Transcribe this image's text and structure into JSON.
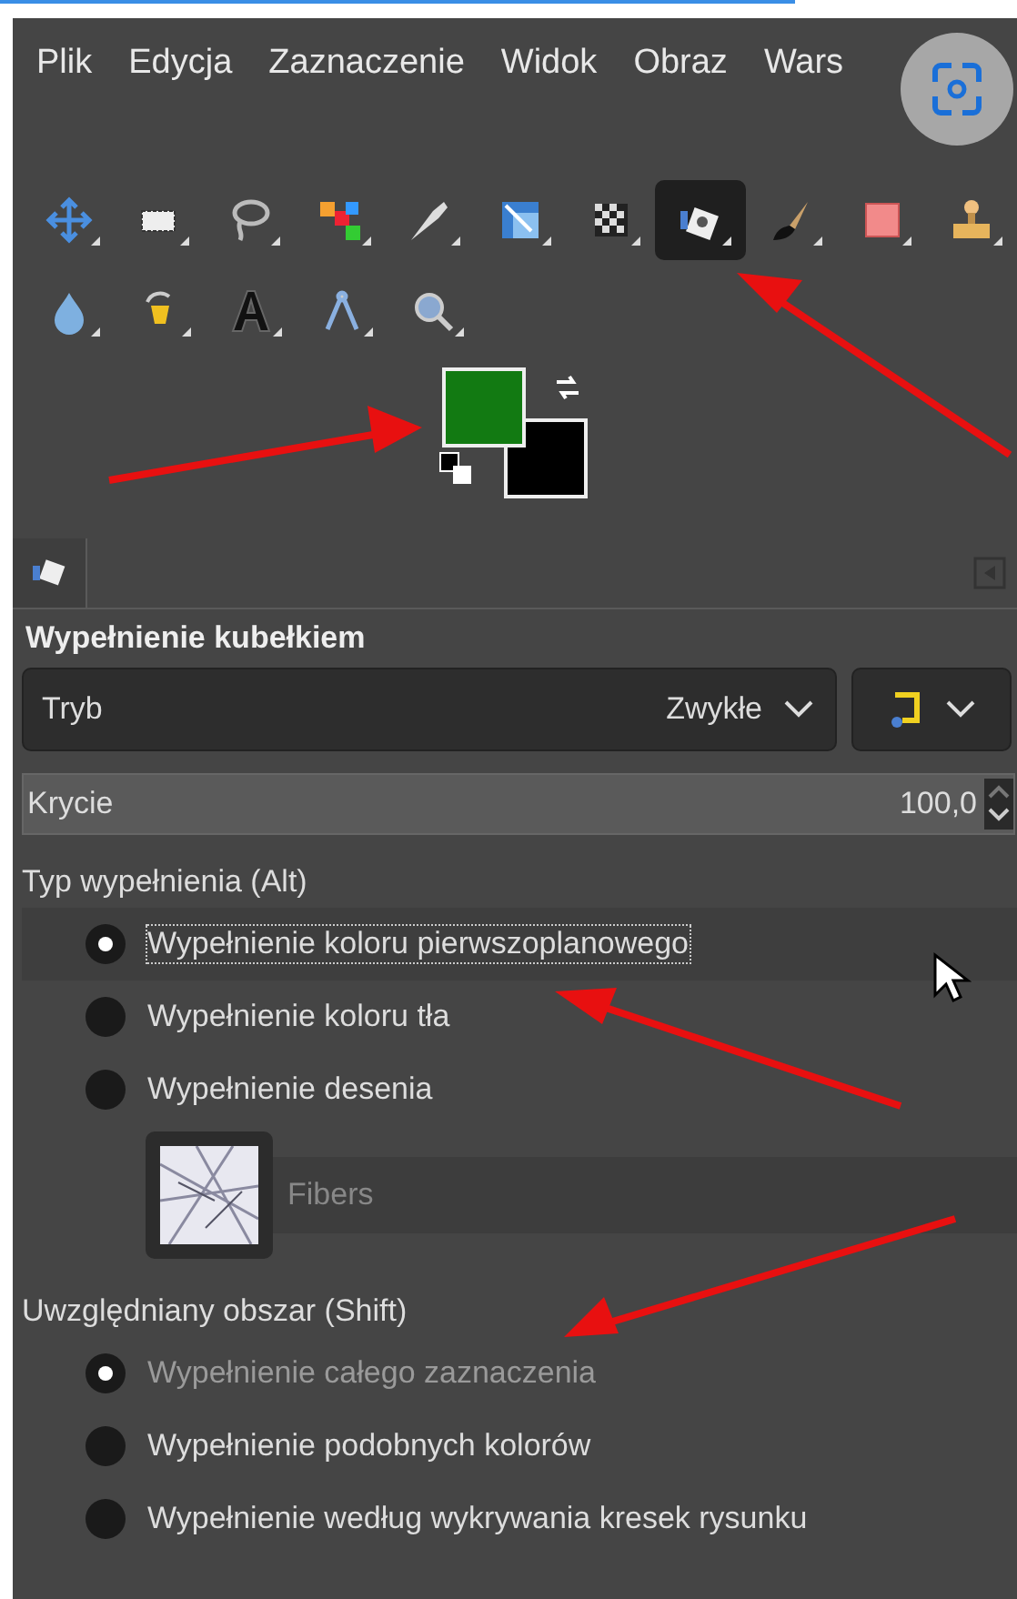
{
  "menu": [
    "Plik",
    "Edycja",
    "Zaznaczenie",
    "Widok",
    "Obraz",
    "Wars"
  ],
  "toolbox": {
    "rows": [
      [
        {
          "kind": "move",
          "selected": false
        },
        {
          "kind": "rectselect",
          "selected": false
        },
        {
          "kind": "lasso",
          "selected": false
        },
        {
          "kind": "colorselect",
          "selected": false
        },
        {
          "kind": "knife",
          "selected": false
        },
        {
          "kind": "transform",
          "selected": false
        },
        {
          "kind": "checker",
          "selected": false
        },
        {
          "kind": "bucket",
          "selected": true
        },
        {
          "kind": "brush",
          "selected": false
        },
        {
          "kind": "eraser",
          "selected": false
        },
        {
          "kind": "stamp",
          "selected": false
        }
      ],
      [
        {
          "kind": "drop",
          "selected": false
        },
        {
          "kind": "pen",
          "selected": false
        },
        {
          "kind": "text",
          "selected": false
        },
        {
          "kind": "measure",
          "selected": false
        },
        {
          "kind": "zoom",
          "selected": false
        }
      ]
    ]
  },
  "tool_options": {
    "title": "Wypełnienie kubełkiem",
    "mode": {
      "label": "Tryb",
      "value": "Zwykłe"
    },
    "opacity": {
      "label": "Krycie",
      "value": "100,0",
      "level": 1.0
    },
    "fill_type": {
      "label": "Typ wypełnienia  (Alt)",
      "options": [
        {
          "label": "Wypełnienie koloru pierwszoplanowego",
          "selected": true,
          "disabled": false
        },
        {
          "label": "Wypełnienie koloru tła",
          "selected": false,
          "disabled": false
        },
        {
          "label": "Wypełnienie desenia",
          "selected": false,
          "disabled": false
        }
      ],
      "pattern": {
        "placeholder": "Fibers"
      }
    },
    "affected_area": {
      "label": "Uwzględniany obszar  (Shift)",
      "options": [
        {
          "label": "Wypełnienie całego zaznaczenia",
          "selected": true,
          "disabled": true
        },
        {
          "label": "Wypełnienie podobnych kolorów",
          "selected": false,
          "disabled": false
        },
        {
          "label": "Wypełnienie według wykrywania kresek rysunku",
          "selected": false,
          "disabled": false
        }
      ]
    }
  }
}
